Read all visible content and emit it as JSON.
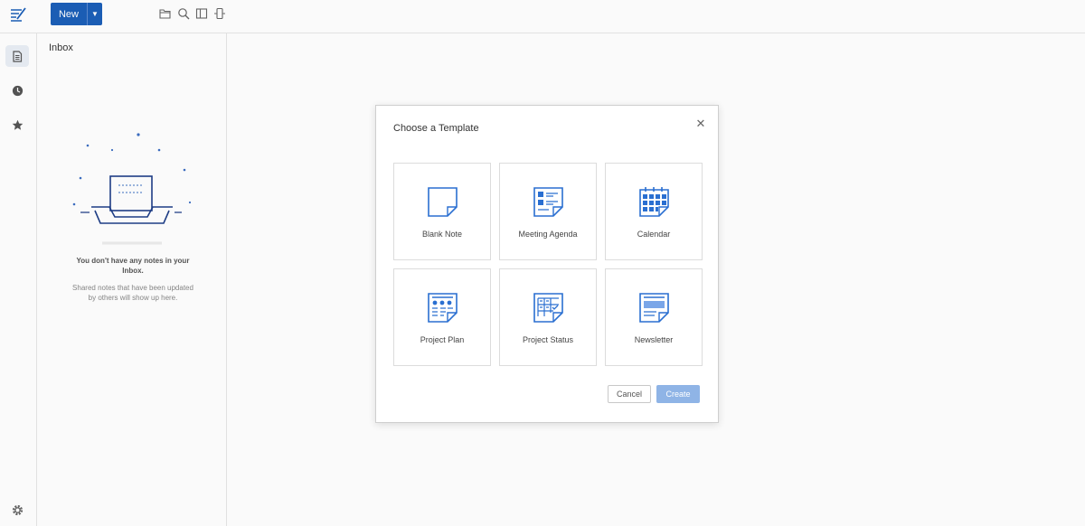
{
  "topbar": {
    "new_label": "New",
    "tools": [
      "folder-icon",
      "search-icon",
      "split-view-icon",
      "share-icon"
    ]
  },
  "rail": {
    "items": [
      {
        "name": "notes",
        "icon": "document-icon",
        "active": true
      },
      {
        "name": "recent",
        "icon": "clock-icon",
        "active": false
      },
      {
        "name": "favorites",
        "icon": "star-icon",
        "active": false
      }
    ],
    "settings_icon": "gear-icon"
  },
  "list": {
    "title": "Inbox",
    "empty_message": "You don't have any notes in your Inbox.",
    "empty_sub": "Shared notes that have been updated by others will show up here."
  },
  "dialog": {
    "title": "Choose a Template",
    "templates": [
      {
        "label": "Blank Note",
        "icon": "blank-note-icon"
      },
      {
        "label": "Meeting Agenda",
        "icon": "meeting-agenda-icon"
      },
      {
        "label": "Calendar",
        "icon": "calendar-icon"
      },
      {
        "label": "Project Plan",
        "icon": "project-plan-icon"
      },
      {
        "label": "Project Status",
        "icon": "project-status-icon"
      },
      {
        "label": "Newsletter",
        "icon": "newsletter-icon"
      }
    ],
    "cancel_label": "Cancel",
    "create_label": "Create"
  },
  "colors": {
    "accent": "#1c5fb8",
    "icon_blue": "#2a6fd1",
    "create_disabled": "#8fb4e6"
  }
}
